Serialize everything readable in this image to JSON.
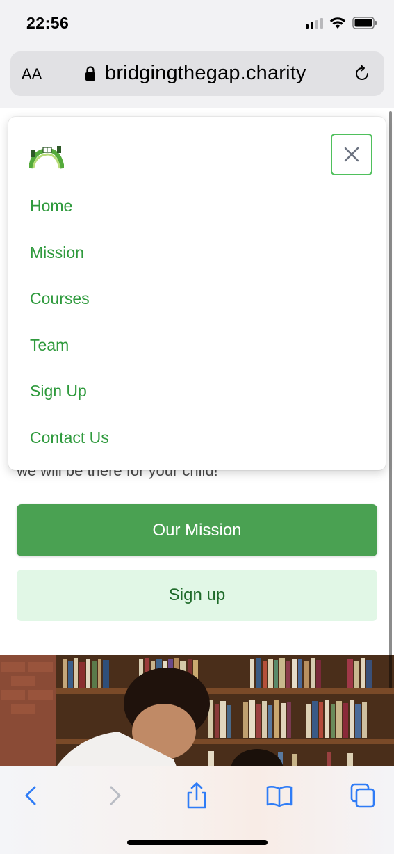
{
  "status_bar": {
    "time": "22:56"
  },
  "browser": {
    "text_size_label": "AA",
    "url": "bridgingthegap.charity"
  },
  "menu": {
    "items": [
      {
        "label": "Home"
      },
      {
        "label": "Mission"
      },
      {
        "label": "Courses"
      },
      {
        "label": "Team"
      },
      {
        "label": "Sign Up"
      },
      {
        "label": "Contact Us"
      }
    ]
  },
  "hero": {
    "partial_text": "we will be there for your child!",
    "primary_button": "Our Mission",
    "secondary_button": "Sign up"
  },
  "colors": {
    "accent_green": "#4aa152",
    "link_green": "#2f9a3d",
    "light_green_bg": "#e1f7e6",
    "ios_blue": "#2f7cf6"
  },
  "toolbar": {
    "icons": [
      "back-icon",
      "forward-icon",
      "share-icon",
      "bookmarks-icon",
      "tabs-icon"
    ]
  }
}
